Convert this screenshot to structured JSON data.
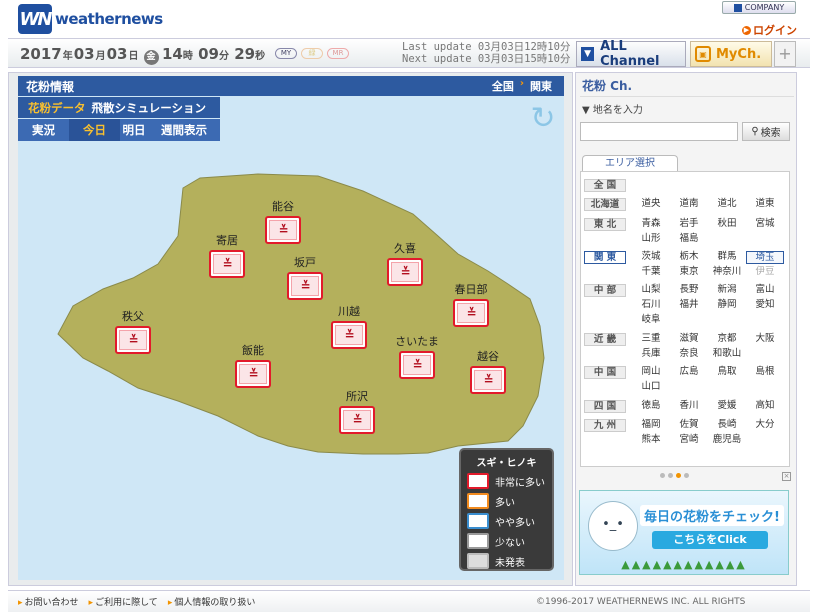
{
  "header": {
    "logo_mark": "WN",
    "logo_text": "weathernews",
    "company_label": "COMPANY",
    "login_label": "ログイン"
  },
  "datebar": {
    "year": "2017",
    "year_unit": "年",
    "month": "03",
    "month_unit": "月",
    "day": "03",
    "day_unit": "日",
    "weekday": "金",
    "hour": "14",
    "hour_unit": "時",
    "minute": "09",
    "minute_unit": "分",
    "second": "29",
    "second_unit": "秒",
    "pills": [
      "MY",
      "緑",
      "MR"
    ],
    "last_update": "Last update  03月03日12時10分",
    "next_update": "Next update  03月03日15時10分"
  },
  "tabs": {
    "all_channel": "ALL Channel",
    "mych": "MyCh.",
    "plus": "+"
  },
  "main": {
    "title": "花粉情報",
    "scope_all": "全国",
    "scope_sep": "›",
    "scope_region": "関東",
    "sub_menu": {
      "data": "花粉データ",
      "sim": "飛散シミュレーション"
    },
    "day_tabs": [
      "実況",
      "今日",
      "明日",
      "週間表示"
    ],
    "active_day_index": 1,
    "refresh_icon": "↻"
  },
  "map": {
    "land_color": "#b4b05c",
    "water_color": "#cfe7f6",
    "face_glyph": "≚",
    "cities": [
      {
        "name": "能谷",
        "level": "非常に多い"
      },
      {
        "name": "寄居",
        "level": "非常に多い"
      },
      {
        "name": "坂戸",
        "level": "非常に多い"
      },
      {
        "name": "久喜",
        "level": "非常に多い"
      },
      {
        "name": "春日部",
        "level": "非常に多い"
      },
      {
        "name": "秩父",
        "level": "非常に多い"
      },
      {
        "name": "川越",
        "level": "非常に多い"
      },
      {
        "name": "さいたま",
        "level": "非常に多い"
      },
      {
        "name": "飯能",
        "level": "非常に多い"
      },
      {
        "name": "越谷",
        "level": "非常に多い"
      },
      {
        "name": "所沢",
        "level": "非常に多い"
      }
    ]
  },
  "legend": {
    "title": "スギ・ヒノキ",
    "items": [
      {
        "label": "非常に多い",
        "color": "#e21a2b"
      },
      {
        "label": "多い",
        "color": "#f28b1e"
      },
      {
        "label": "やや多い",
        "color": "#3a8ed0"
      },
      {
        "label": "少ない",
        "color": "#9a9a9a"
      },
      {
        "label": "未発表",
        "color": "#ffffff"
      }
    ]
  },
  "side": {
    "title": "花粉 Ch.",
    "address_label": "▼ 地名を入力",
    "search_placeholder": "",
    "search_button": "検索",
    "area_tab": "エリア選択",
    "regions": [
      {
        "label": "全 国",
        "prefs": []
      },
      {
        "label": "北海道",
        "prefs": [
          "道央",
          "道南",
          "道北",
          "道東"
        ]
      },
      {
        "label": "東 北",
        "prefs": [
          "青森",
          "岩手",
          "秋田",
          "宮城",
          "山形",
          "福島"
        ]
      },
      {
        "label": "関 東",
        "prefs": [
          "茨城",
          "栃木",
          "群馬",
          "埼玉",
          "千葉",
          "東京",
          "神奈川",
          "伊豆"
        ]
      },
      {
        "label": "中 部",
        "prefs": [
          "山梨",
          "長野",
          "新潟",
          "富山",
          "石川",
          "福井",
          "静岡",
          "愛知",
          "岐阜"
        ]
      },
      {
        "label": "近 畿",
        "prefs": [
          "三重",
          "滋賀",
          "京都",
          "大阪",
          "兵庫",
          "奈良",
          "和歌山"
        ]
      },
      {
        "label": "中 国",
        "prefs": [
          "岡山",
          "広島",
          "鳥取",
          "島根",
          "山口"
        ]
      },
      {
        "label": "四 国",
        "prefs": [
          "徳島",
          "香川",
          "愛媛",
          "高知"
        ]
      },
      {
        "label": "九 州",
        "prefs": [
          "福岡",
          "佐賀",
          "長崎",
          "大分",
          "熊本",
          "宮崎",
          "鹿児島"
        ]
      }
    ],
    "banner_text1": "毎日の花粉をチェック!",
    "banner_text2": "こちらをClick",
    "banner_trees": "▲▲▲▲▲▲▲▲▲▲▲▲",
    "close_glyph": "×"
  },
  "footer": {
    "links": [
      "お問い合わせ",
      "ご利用に際して",
      "個人情報の取り扱い"
    ],
    "copyright": "©1996-2017 WEATHERNEWS INC. ALL RIGHTS"
  },
  "colors": {
    "brand_blue": "#2d5aa0",
    "accent_orange": "#f29400",
    "alert_red": "#e21a2b"
  }
}
